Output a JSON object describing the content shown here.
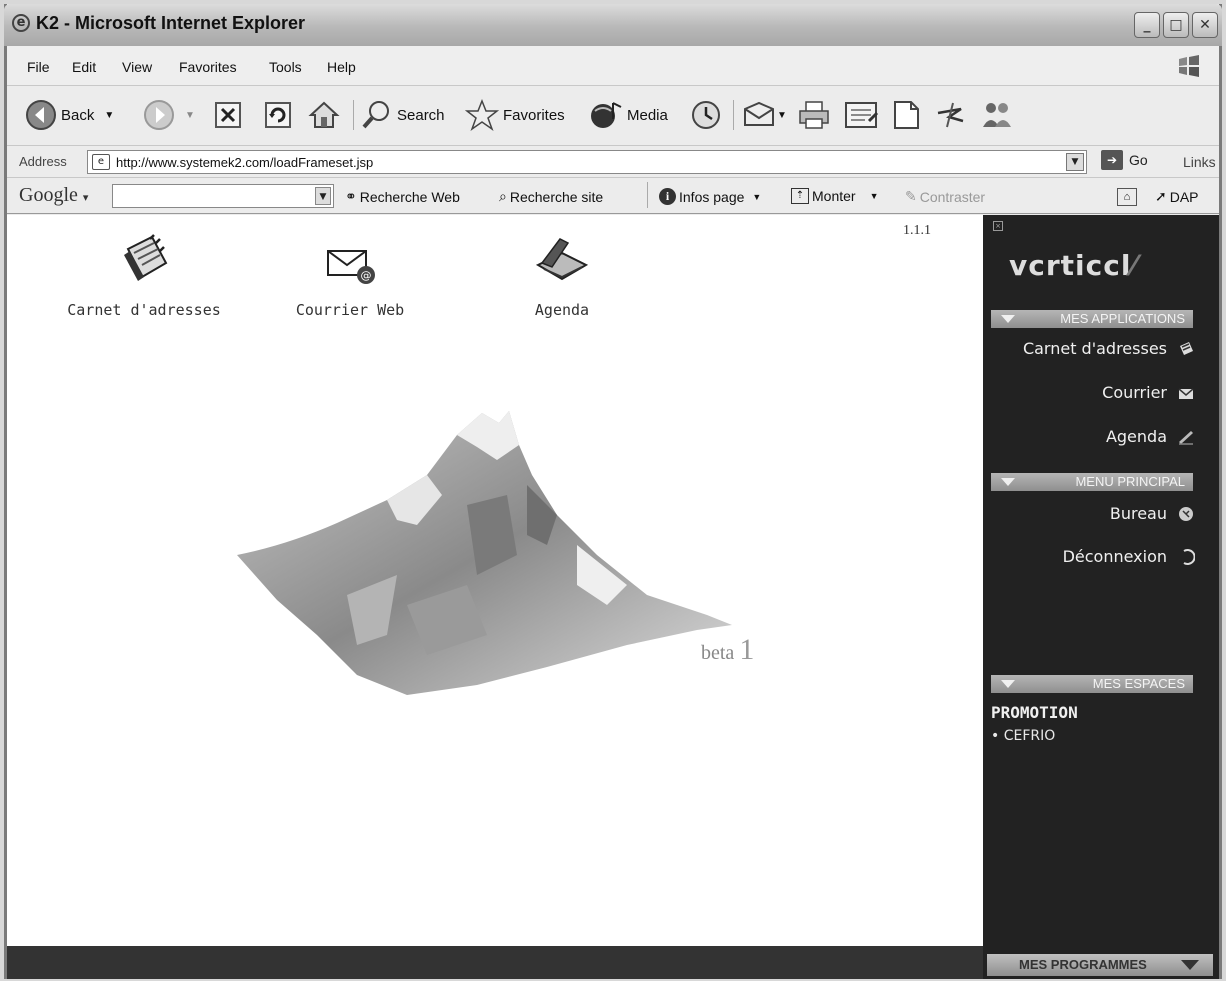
{
  "window": {
    "title": "K2 - Microsoft Internet Explorer"
  },
  "menubar": {
    "items": [
      "File",
      "Edit",
      "View",
      "Favorites",
      "Tools",
      "Help"
    ]
  },
  "toolbar": {
    "back_label": "Back",
    "search_label": "Search",
    "favorites_label": "Favorites",
    "media_label": "Media"
  },
  "address": {
    "label": "Address",
    "url": "http://www.systemek2.com/loadFrameset.jsp",
    "go_label": "Go",
    "links_label": "Links"
  },
  "googlebar": {
    "logo": "Google",
    "web_search": "Recherche Web",
    "site_search": "Recherche site",
    "page_info": "Infos page",
    "up": "Monter",
    "contrast": "Contraster",
    "dap": "DAP"
  },
  "content": {
    "version": "1.1.1",
    "apps": [
      {
        "label": "Carnet d'adresses",
        "icon": "address-book-icon"
      },
      {
        "label": "Courrier Web",
        "icon": "mail-icon"
      },
      {
        "label": "Agenda",
        "icon": "agenda-icon"
      }
    ],
    "beta_text": "beta",
    "beta_number": "1"
  },
  "sidebar": {
    "logo_text": "vcrticcl",
    "logo_slash": "⁄",
    "applications_header": "MES APPLICATIONS",
    "applications": [
      {
        "label": "Carnet d'adresses",
        "icon": "address-book-icon"
      },
      {
        "label": "Courrier",
        "icon": "mail-icon"
      },
      {
        "label": "Agenda",
        "icon": "pen-icon"
      }
    ],
    "main_menu_header": "MENU PRINCIPAL",
    "main_menu": [
      {
        "label": "Bureau",
        "icon": "desk-icon"
      },
      {
        "label": "Déconnexion",
        "icon": "logout-icon"
      }
    ],
    "spaces_header": "MES ESPACES",
    "space_title": "PROMOTION",
    "space_item": "• CEFRIO"
  },
  "footer": {
    "programs_label": "MES PROGRAMMES"
  }
}
